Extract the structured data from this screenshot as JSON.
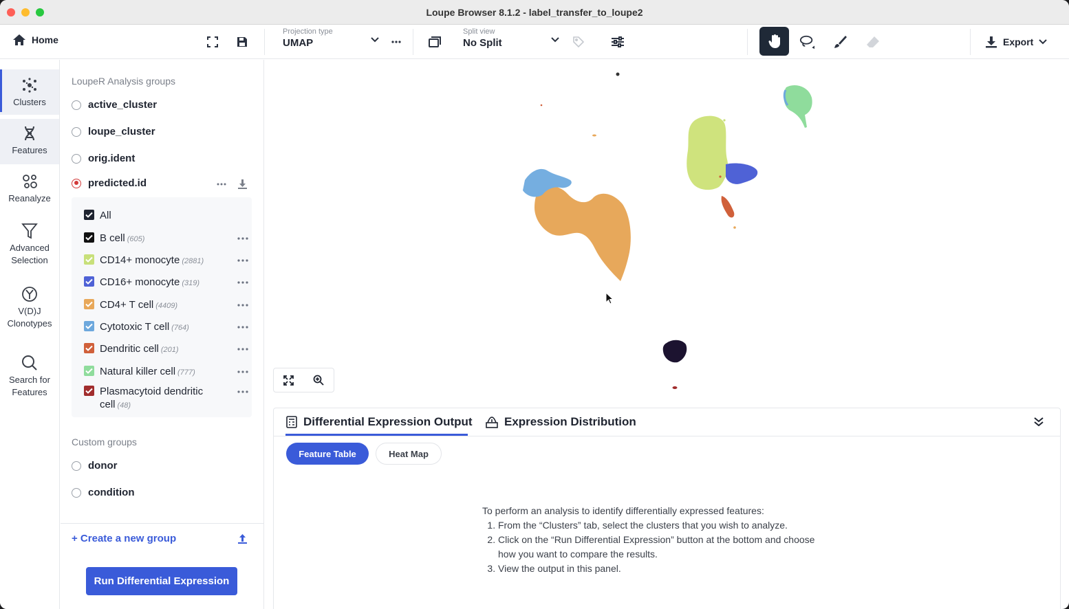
{
  "window": {
    "title": "Loupe Browser 8.1.2 - label_transfer_to_loupe2"
  },
  "toolbar": {
    "home_label": "Home",
    "projection": {
      "label": "Projection type",
      "value": "UMAP"
    },
    "split": {
      "label": "Split view",
      "value": "No Split"
    },
    "export_label": "Export"
  },
  "rail": {
    "items": [
      {
        "label": "Clusters",
        "icon": "clusters-icon"
      },
      {
        "label": "Features",
        "icon": "features-icon"
      },
      {
        "label": "Reanalyze",
        "icon": "reanalyze-icon"
      },
      {
        "label_1": "Advanced",
        "label_2": "Selection",
        "icon": "filter-icon"
      },
      {
        "label_1": "V(D)J",
        "label_2": "Clonotypes",
        "icon": "vdj-icon"
      },
      {
        "label_1": "Search for",
        "label_2": "Features",
        "icon": "search-icon"
      }
    ]
  },
  "groups": {
    "loupe_title": "LoupeR Analysis groups",
    "loupe_groups": [
      "active_cluster",
      "loupe_cluster",
      "orig.ident",
      "predicted.id"
    ],
    "selected_group": "predicted.id",
    "all_label": "All",
    "clusters": [
      {
        "name": "B cell",
        "count": "(605)",
        "color": "#111111"
      },
      {
        "name": "CD14+ monocyte",
        "count": "(2881)",
        "color": "#c8e07a"
      },
      {
        "name": "CD16+ monocyte",
        "count": "(319)",
        "color": "#4f62d6"
      },
      {
        "name": "CD4+ T cell",
        "count": "(4409)",
        "color": "#e8a85a"
      },
      {
        "name": "Cytotoxic T cell",
        "count": "(764)",
        "color": "#6da8dd"
      },
      {
        "name": "Dendritic cell",
        "count": "(201)",
        "color": "#d0603a"
      },
      {
        "name": "Natural killer cell",
        "count": "(777)",
        "color": "#8fdc9c"
      },
      {
        "name_1": "Plasmacytoid dendritic",
        "name_2": "cell",
        "count": "(48)",
        "color": "#a12d2d"
      }
    ],
    "custom_title": "Custom groups",
    "custom_groups": [
      "donor",
      "condition"
    ],
    "create_label": "+ Create a new group",
    "run_button": "Run Differential Expression"
  },
  "bottom": {
    "tabs": [
      "Differential Expression Output",
      "Expression Distribution"
    ],
    "active_tab": "Differential Expression Output",
    "pills": [
      "Feature Table",
      "Heat Map"
    ],
    "active_pill": "Feature Table",
    "intro": "To perform an analysis to identify differentially expressed features:",
    "steps": [
      "From the “Clusters” tab, select the clusters that you wish to analyze.",
      "Click on the “Run Differential Expression” button at the bottom and choose",
      "View the output in this panel."
    ],
    "step2_cont": "how you want to compare the results."
  },
  "colors": {
    "accent": "#3a5bd9",
    "selected_radio": "#d23b3b"
  }
}
